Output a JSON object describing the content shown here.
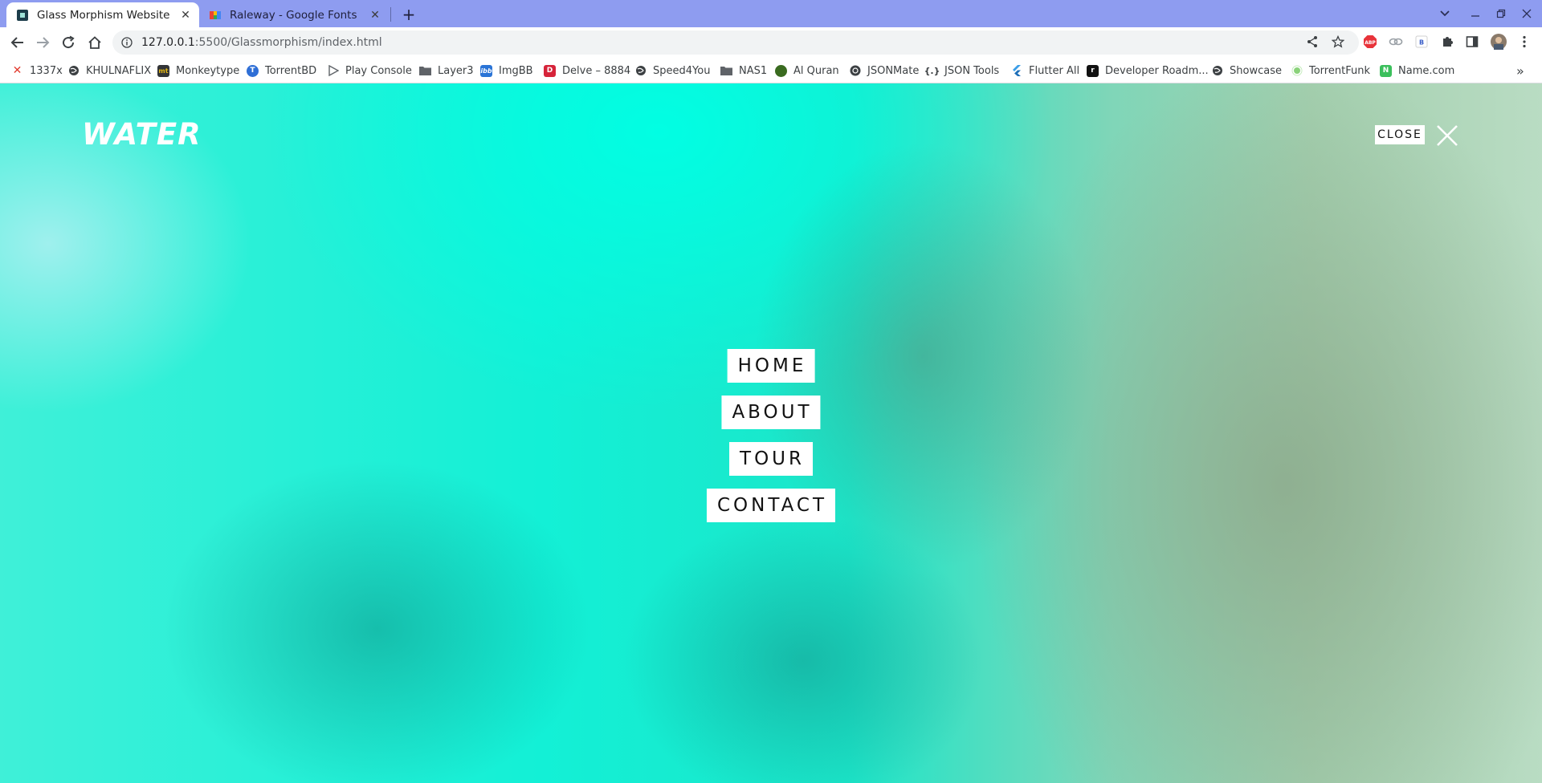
{
  "browser": {
    "tabs": [
      {
        "title": "Glass Morphism Website",
        "active": true,
        "icon": "glass-favicon"
      },
      {
        "title": "Raleway - Google Fonts",
        "active": false,
        "icon": "google-fonts-favicon"
      }
    ],
    "new_tab": "+",
    "url_host": "127.0.0.1",
    "url_rest": ":5500/Glassmorphism/index.html",
    "bookmarks": [
      {
        "label": "1337x",
        "icon": "x-logo",
        "color": "#e23b2e"
      },
      {
        "label": "KHULNAFLIX",
        "icon": "globe",
        "color": "#3c4043"
      },
      {
        "label": "Monkeytype",
        "icon": "monkeytype",
        "color": "#323437"
      },
      {
        "label": "TorrentBD",
        "icon": "torrentbd",
        "color": "#2f6fd6"
      },
      {
        "label": "Play Console",
        "icon": "play",
        "color": "#5f6368"
      },
      {
        "label": "Layer3",
        "icon": "folder",
        "color": "#5f6368"
      },
      {
        "label": "ImgBB",
        "icon": "imgbb",
        "color": "#2a74d6"
      },
      {
        "label": "Delve – 8884",
        "icon": "delve",
        "color": "#d6243a"
      },
      {
        "label": "Speed4You",
        "icon": "globe",
        "color": "#3c4043"
      },
      {
        "label": "NAS1",
        "icon": "folder",
        "color": "#5f6368"
      },
      {
        "label": "Al Quran",
        "icon": "quran",
        "color": "#3a6b20"
      },
      {
        "label": "JSONMate",
        "icon": "jsonmate",
        "color": "#3c4043"
      },
      {
        "label": "JSON Tools",
        "icon": "braces",
        "color": "#3c4043"
      },
      {
        "label": "Flutter All",
        "icon": "flutter",
        "color": "#3b9ee8"
      },
      {
        "label": "Developer Roadm...",
        "icon": "roadmap",
        "color": "#111111"
      },
      {
        "label": "Showcase",
        "icon": "globe",
        "color": "#3c4043"
      },
      {
        "label": "TorrentFunk",
        "icon": "torrentfunk",
        "color": "#8ad27a"
      },
      {
        "label": "Name.com",
        "icon": "namecom",
        "color": "#3bbf5c"
      }
    ],
    "more_bookmarks": "»"
  },
  "page": {
    "logo": "WATER",
    "close_label": "CLOSE",
    "menu": [
      {
        "label": "HOME"
      },
      {
        "label": "ABOUT"
      },
      {
        "label": "TOUR"
      },
      {
        "label": "CONTACT"
      }
    ]
  },
  "colors": {
    "tabstrip": "#8e9cf0",
    "page_primary": "#13f0d6",
    "page_secondary": "#a3cfae"
  }
}
